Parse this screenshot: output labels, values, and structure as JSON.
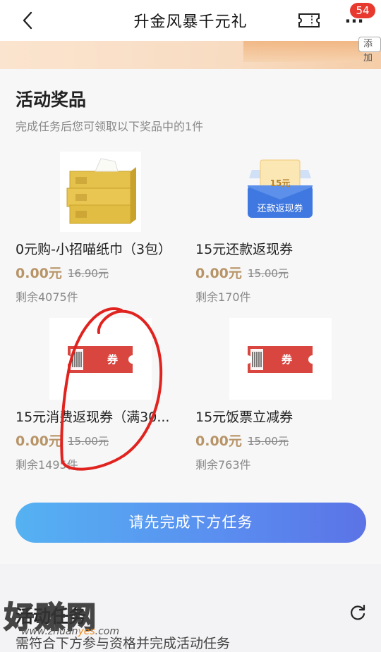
{
  "header": {
    "title": "升金风暴千元礼",
    "badge_count": "54"
  },
  "banner": {
    "add_label": "添加"
  },
  "prizes_section": {
    "title": "活动奖品",
    "subtitle": "完成任务后您可领取以下奖品中的1件",
    "items": [
      {
        "name": "0元购-小招喵纸巾（3包）",
        "price": "0.00元",
        "original_price": "16.90元",
        "stock": "剩余4075件",
        "image": "tissue-pack"
      },
      {
        "name": "15元还款返现券",
        "price": "0.00元",
        "original_price": "15.00元",
        "stock": "剩余170件",
        "image": "repayment-coupon",
        "image_amount": "15元",
        "image_label": "还款返现券"
      },
      {
        "name": "15元消费返现券（满30...",
        "price": "0.00元",
        "original_price": "15.00元",
        "stock": "剩余1495件",
        "image": "coupon-ticket",
        "ticket_label": "券"
      },
      {
        "name": "15元饭票立减券",
        "price": "0.00元",
        "original_price": "15.00元",
        "stock": "剩余763件",
        "image": "coupon-ticket",
        "ticket_label": "券"
      }
    ],
    "cta_label": "请先完成下方任务"
  },
  "tasks_section": {
    "title": "活动任务",
    "subtitle": "需符合下方参与资格并完成活动任务"
  },
  "watermark": {
    "logo": "好赚网",
    "url_prefix": "www.zhuan",
    "url_highlight": "yes",
    "url_suffix": ".com"
  },
  "colors": {
    "price": "#b89568",
    "cta_start": "#55b2f2",
    "cta_end": "#5b73e6",
    "badge": "#e8392f",
    "ticket": "#d9453f",
    "scribble": "#e0231f"
  }
}
